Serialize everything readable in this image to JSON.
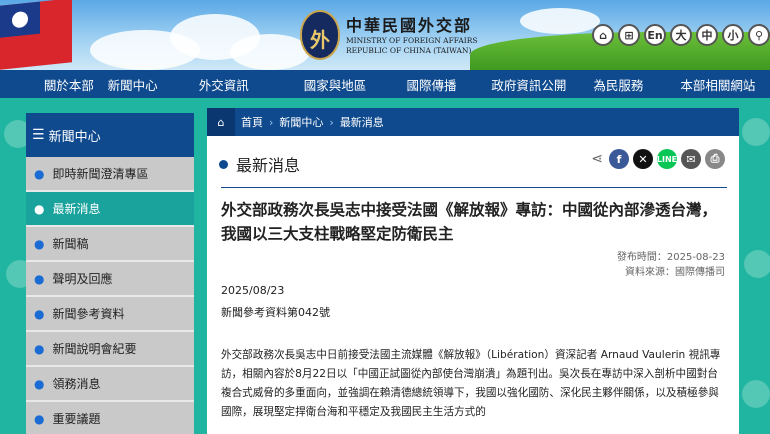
{
  "header": {
    "logo_zh": "中華民國外交部",
    "logo_en_line1": "MINISTRY OF FOREIGN AFFAIRS",
    "logo_en_line2": "REPUBLIC OF CHINA (TAIWAN)",
    "toolbar": [
      "En",
      "大",
      "中",
      "小"
    ]
  },
  "nav": {
    "items": [
      "關於本部",
      "新聞中心",
      "外交資訊",
      "國家與地區",
      "國際傳播",
      "政府資訊公開",
      "為民服務",
      "本部相關網站"
    ]
  },
  "sidebar": {
    "title": "新聞中心",
    "items": [
      "即時新聞澄清專區",
      "最新消息",
      "新聞稿",
      "聲明及回應",
      "新聞參考資料",
      "新聞說明會紀要",
      "領務消息",
      "重要議題"
    ],
    "active_index": 1
  },
  "breadcrumb": {
    "items": [
      "首頁",
      "新聞中心",
      "最新消息"
    ]
  },
  "content": {
    "section_title": "最新消息",
    "headline": "外交部政務次長吳志中接受法國《解放報》專訪：中國從內部滲透台灣，我國以三大支柱戰略堅定防衛民主",
    "publish_date": "發布時間：2025-08-23",
    "source": "資料來源：國際傳播司",
    "date": "2025/08/23",
    "ref_no": "新聞參考資料第042號",
    "body": "外交部政務次長吳志中日前接受法國主流媒體《解放報》（Libération）資深記者 Arnaud Vaulerin 視訊專訪，相關內容於8月22日以「中國正試圖從內部使台灣崩潰」為題刊出。吳次長在專訪中深入剖析中國對台複合式威脅的多重面向，並強調在賴清德總統領導下，我國以強化國防、深化民主夥伴關係，以及積極參與國際，展現堅定捍衛台海和平穩定及我國民主生活方式的"
  },
  "share_icons": [
    "facebook-icon",
    "x-icon",
    "line-icon",
    "email-icon",
    "print-icon"
  ],
  "colors": {
    "navy": "#0f4a8e",
    "teal": "#1fb5a0",
    "active": "#1aa39c"
  }
}
